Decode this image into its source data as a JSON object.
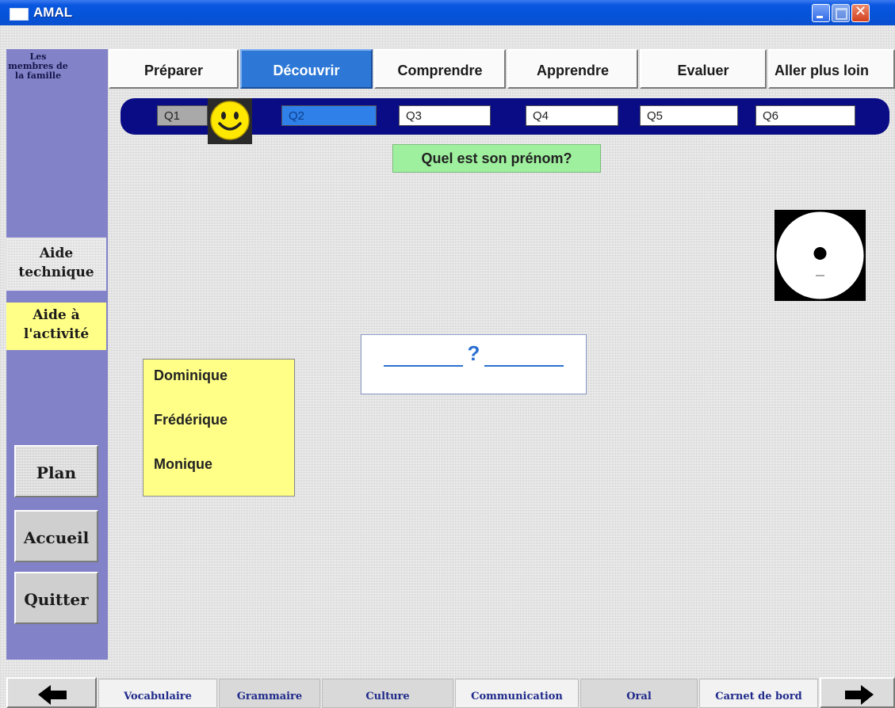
{
  "window": {
    "title": "AMAL"
  },
  "sidebar": {
    "topic_label": "Les membres de la famille",
    "help_technical": "Aide technique",
    "help_activity": "Aide à l'activité",
    "nav": {
      "plan": "Plan",
      "home": "Accueil",
      "quit": "Quitter"
    }
  },
  "tabs": [
    {
      "label": "Préparer",
      "active": false
    },
    {
      "label": "Découvrir",
      "active": true
    },
    {
      "label": "Comprendre",
      "active": false
    },
    {
      "label": "Apprendre",
      "active": false
    },
    {
      "label": "Evaluer",
      "active": false
    },
    {
      "label": "Aller plus loin",
      "active": false
    }
  ],
  "questions": [
    {
      "label": "Q1",
      "state": "answered"
    },
    {
      "label": "Q2",
      "state": "current"
    },
    {
      "label": "Q3",
      "state": "pending"
    },
    {
      "label": "Q4",
      "state": "pending"
    },
    {
      "label": "Q5",
      "state": "pending"
    },
    {
      "label": "Q6",
      "state": "pending"
    }
  ],
  "prompt": "Quel est son prénom?",
  "answer": {
    "placeholder": "?"
  },
  "choices": [
    "Dominique",
    "Frédérique",
    "Monique"
  ],
  "bottom_tabs": [
    "Vocabulaire",
    "Grammaire",
    "Culture",
    "Communication",
    "Oral",
    "Carnet de bord"
  ],
  "colors": {
    "title_bar": "#0553d8",
    "sidebar": "#8282c8",
    "active_tab": "#2d78d6",
    "question_bar": "#0a0c85",
    "prompt_bg": "#9ef09e",
    "highlight_yellow": "#ffff88",
    "answer_text": "#2a6fd0",
    "bottom_tab_text": "#1f2a8a"
  },
  "icons": {
    "feedback": "smiley-face-icon",
    "audio": "audio-cd-icon",
    "prev": "left-arrow-icon",
    "next": "right-arrow-icon"
  }
}
